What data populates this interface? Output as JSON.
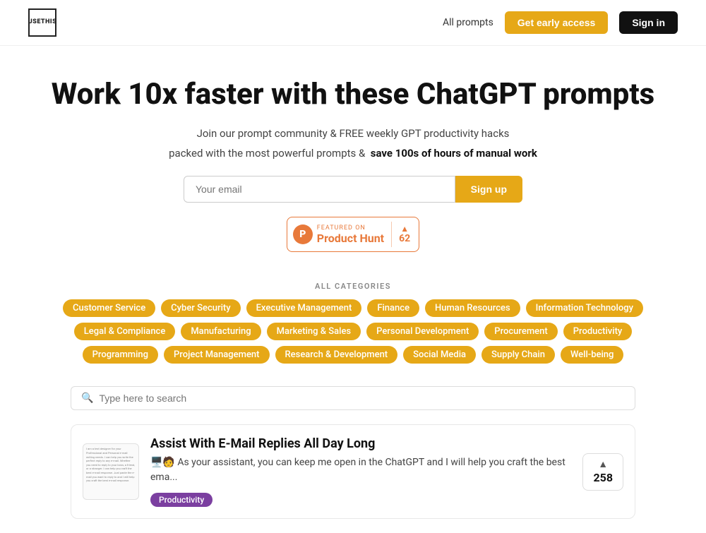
{
  "nav": {
    "logo_line1": "USE",
    "logo_line2": "THIS",
    "all_prompts_label": "All prompts",
    "early_access_label": "Get early access",
    "signin_label": "Sign in"
  },
  "hero": {
    "title": "Work 10x faster with these ChatGPT prompts",
    "subtitle_normal": "Join our prompt community & FREE weekly GPT productivity hacks",
    "subtitle_bold": "packed with the most powerful prompts &",
    "subtitle_strong": "save 100s of hours of manual work",
    "email_placeholder": "Your email",
    "signup_label": "Sign up"
  },
  "product_hunt": {
    "featured_label": "FEATURED ON",
    "name": "Product Hunt",
    "icon_letter": "P",
    "vote_count": "62"
  },
  "categories": {
    "label": "ALL CATEGORIES",
    "tags": [
      "Customer Service",
      "Cyber Security",
      "Executive Management",
      "Finance",
      "Human Resources",
      "Information Technology",
      "Legal & Compliance",
      "Manufacturing",
      "Marketing & Sales",
      "Personal Development",
      "Procurement",
      "Productivity",
      "Programming",
      "Project Management",
      "Research & Development",
      "Social Media",
      "Supply Chain",
      "Well-being"
    ]
  },
  "search": {
    "placeholder": "Type here to search"
  },
  "card": {
    "title": "Assist With E-Mail Replies All Day Long",
    "description": "🖥️🧑 As your assistant, you can keep me open in the ChatGPT and I will help you craft the best ema...",
    "tag": "Productivity",
    "vote_count": "258",
    "preview_lines": [
      "I am a text designer for your Professional and Personal e-mail writing needs.",
      "I can help you write the perfect reply to any e-mail.",
      "Whether you need to reply to your boss, a friend, or a stranger.",
      "I can help you craft the best e-mail response.",
      "Just paste the e-mail you want to reply to and I will help you craft the best e-mail response."
    ]
  }
}
